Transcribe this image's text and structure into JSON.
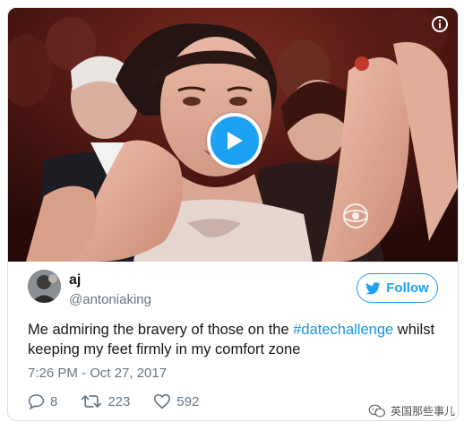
{
  "tweet": {
    "display_name": "aj",
    "handle": "@antoniaking",
    "follow_label": "Follow",
    "text_before": "Me admiring the bravery of those on the ",
    "hashtag": "#datechallenge",
    "text_after": " whilst keeping my feet firmly in my comfort zone",
    "timestamp": "7:26 PM - Oct 27, 2017",
    "replies": "8",
    "retweets": "223",
    "likes": "592"
  },
  "media": {
    "type": "video",
    "play_icon": "play-icon",
    "info_icon": "info-icon"
  },
  "watermark": {
    "text": "英国那些事儿"
  },
  "colors": {
    "accent": "#1da1f2",
    "hashtag": "#1b95e0",
    "text": "#14171a",
    "secondary": "#657786",
    "border": "#d9dee3"
  }
}
